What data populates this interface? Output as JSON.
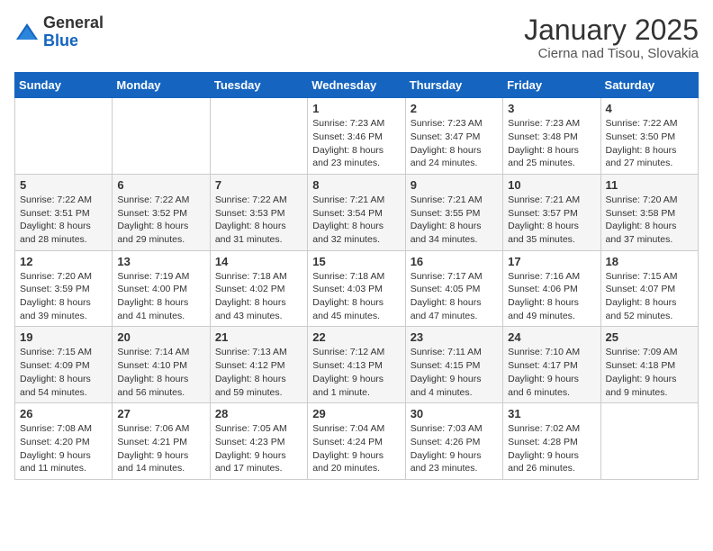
{
  "header": {
    "logo_general": "General",
    "logo_blue": "Blue",
    "month_title": "January 2025",
    "subtitle": "Cierna nad Tisou, Slovakia"
  },
  "weekdays": [
    "Sunday",
    "Monday",
    "Tuesday",
    "Wednesday",
    "Thursday",
    "Friday",
    "Saturday"
  ],
  "weeks": [
    [
      {
        "day": "",
        "sunrise": "",
        "sunset": "",
        "daylight": ""
      },
      {
        "day": "",
        "sunrise": "",
        "sunset": "",
        "daylight": ""
      },
      {
        "day": "",
        "sunrise": "",
        "sunset": "",
        "daylight": ""
      },
      {
        "day": "1",
        "sunrise": "Sunrise: 7:23 AM",
        "sunset": "Sunset: 3:46 PM",
        "daylight": "Daylight: 8 hours and 23 minutes."
      },
      {
        "day": "2",
        "sunrise": "Sunrise: 7:23 AM",
        "sunset": "Sunset: 3:47 PM",
        "daylight": "Daylight: 8 hours and 24 minutes."
      },
      {
        "day": "3",
        "sunrise": "Sunrise: 7:23 AM",
        "sunset": "Sunset: 3:48 PM",
        "daylight": "Daylight: 8 hours and 25 minutes."
      },
      {
        "day": "4",
        "sunrise": "Sunrise: 7:22 AM",
        "sunset": "Sunset: 3:50 PM",
        "daylight": "Daylight: 8 hours and 27 minutes."
      }
    ],
    [
      {
        "day": "5",
        "sunrise": "Sunrise: 7:22 AM",
        "sunset": "Sunset: 3:51 PM",
        "daylight": "Daylight: 8 hours and 28 minutes."
      },
      {
        "day": "6",
        "sunrise": "Sunrise: 7:22 AM",
        "sunset": "Sunset: 3:52 PM",
        "daylight": "Daylight: 8 hours and 29 minutes."
      },
      {
        "day": "7",
        "sunrise": "Sunrise: 7:22 AM",
        "sunset": "Sunset: 3:53 PM",
        "daylight": "Daylight: 8 hours and 31 minutes."
      },
      {
        "day": "8",
        "sunrise": "Sunrise: 7:21 AM",
        "sunset": "Sunset: 3:54 PM",
        "daylight": "Daylight: 8 hours and 32 minutes."
      },
      {
        "day": "9",
        "sunrise": "Sunrise: 7:21 AM",
        "sunset": "Sunset: 3:55 PM",
        "daylight": "Daylight: 8 hours and 34 minutes."
      },
      {
        "day": "10",
        "sunrise": "Sunrise: 7:21 AM",
        "sunset": "Sunset: 3:57 PM",
        "daylight": "Daylight: 8 hours and 35 minutes."
      },
      {
        "day": "11",
        "sunrise": "Sunrise: 7:20 AM",
        "sunset": "Sunset: 3:58 PM",
        "daylight": "Daylight: 8 hours and 37 minutes."
      }
    ],
    [
      {
        "day": "12",
        "sunrise": "Sunrise: 7:20 AM",
        "sunset": "Sunset: 3:59 PM",
        "daylight": "Daylight: 8 hours and 39 minutes."
      },
      {
        "day": "13",
        "sunrise": "Sunrise: 7:19 AM",
        "sunset": "Sunset: 4:00 PM",
        "daylight": "Daylight: 8 hours and 41 minutes."
      },
      {
        "day": "14",
        "sunrise": "Sunrise: 7:18 AM",
        "sunset": "Sunset: 4:02 PM",
        "daylight": "Daylight: 8 hours and 43 minutes."
      },
      {
        "day": "15",
        "sunrise": "Sunrise: 7:18 AM",
        "sunset": "Sunset: 4:03 PM",
        "daylight": "Daylight: 8 hours and 45 minutes."
      },
      {
        "day": "16",
        "sunrise": "Sunrise: 7:17 AM",
        "sunset": "Sunset: 4:05 PM",
        "daylight": "Daylight: 8 hours and 47 minutes."
      },
      {
        "day": "17",
        "sunrise": "Sunrise: 7:16 AM",
        "sunset": "Sunset: 4:06 PM",
        "daylight": "Daylight: 8 hours and 49 minutes."
      },
      {
        "day": "18",
        "sunrise": "Sunrise: 7:15 AM",
        "sunset": "Sunset: 4:07 PM",
        "daylight": "Daylight: 8 hours and 52 minutes."
      }
    ],
    [
      {
        "day": "19",
        "sunrise": "Sunrise: 7:15 AM",
        "sunset": "Sunset: 4:09 PM",
        "daylight": "Daylight: 8 hours and 54 minutes."
      },
      {
        "day": "20",
        "sunrise": "Sunrise: 7:14 AM",
        "sunset": "Sunset: 4:10 PM",
        "daylight": "Daylight: 8 hours and 56 minutes."
      },
      {
        "day": "21",
        "sunrise": "Sunrise: 7:13 AM",
        "sunset": "Sunset: 4:12 PM",
        "daylight": "Daylight: 8 hours and 59 minutes."
      },
      {
        "day": "22",
        "sunrise": "Sunrise: 7:12 AM",
        "sunset": "Sunset: 4:13 PM",
        "daylight": "Daylight: 9 hours and 1 minute."
      },
      {
        "day": "23",
        "sunrise": "Sunrise: 7:11 AM",
        "sunset": "Sunset: 4:15 PM",
        "daylight": "Daylight: 9 hours and 4 minutes."
      },
      {
        "day": "24",
        "sunrise": "Sunrise: 7:10 AM",
        "sunset": "Sunset: 4:17 PM",
        "daylight": "Daylight: 9 hours and 6 minutes."
      },
      {
        "day": "25",
        "sunrise": "Sunrise: 7:09 AM",
        "sunset": "Sunset: 4:18 PM",
        "daylight": "Daylight: 9 hours and 9 minutes."
      }
    ],
    [
      {
        "day": "26",
        "sunrise": "Sunrise: 7:08 AM",
        "sunset": "Sunset: 4:20 PM",
        "daylight": "Daylight: 9 hours and 11 minutes."
      },
      {
        "day": "27",
        "sunrise": "Sunrise: 7:06 AM",
        "sunset": "Sunset: 4:21 PM",
        "daylight": "Daylight: 9 hours and 14 minutes."
      },
      {
        "day": "28",
        "sunrise": "Sunrise: 7:05 AM",
        "sunset": "Sunset: 4:23 PM",
        "daylight": "Daylight: 9 hours and 17 minutes."
      },
      {
        "day": "29",
        "sunrise": "Sunrise: 7:04 AM",
        "sunset": "Sunset: 4:24 PM",
        "daylight": "Daylight: 9 hours and 20 minutes."
      },
      {
        "day": "30",
        "sunrise": "Sunrise: 7:03 AM",
        "sunset": "Sunset: 4:26 PM",
        "daylight": "Daylight: 9 hours and 23 minutes."
      },
      {
        "day": "31",
        "sunrise": "Sunrise: 7:02 AM",
        "sunset": "Sunset: 4:28 PM",
        "daylight": "Daylight: 9 hours and 26 minutes."
      },
      {
        "day": "",
        "sunrise": "",
        "sunset": "",
        "daylight": ""
      }
    ]
  ]
}
